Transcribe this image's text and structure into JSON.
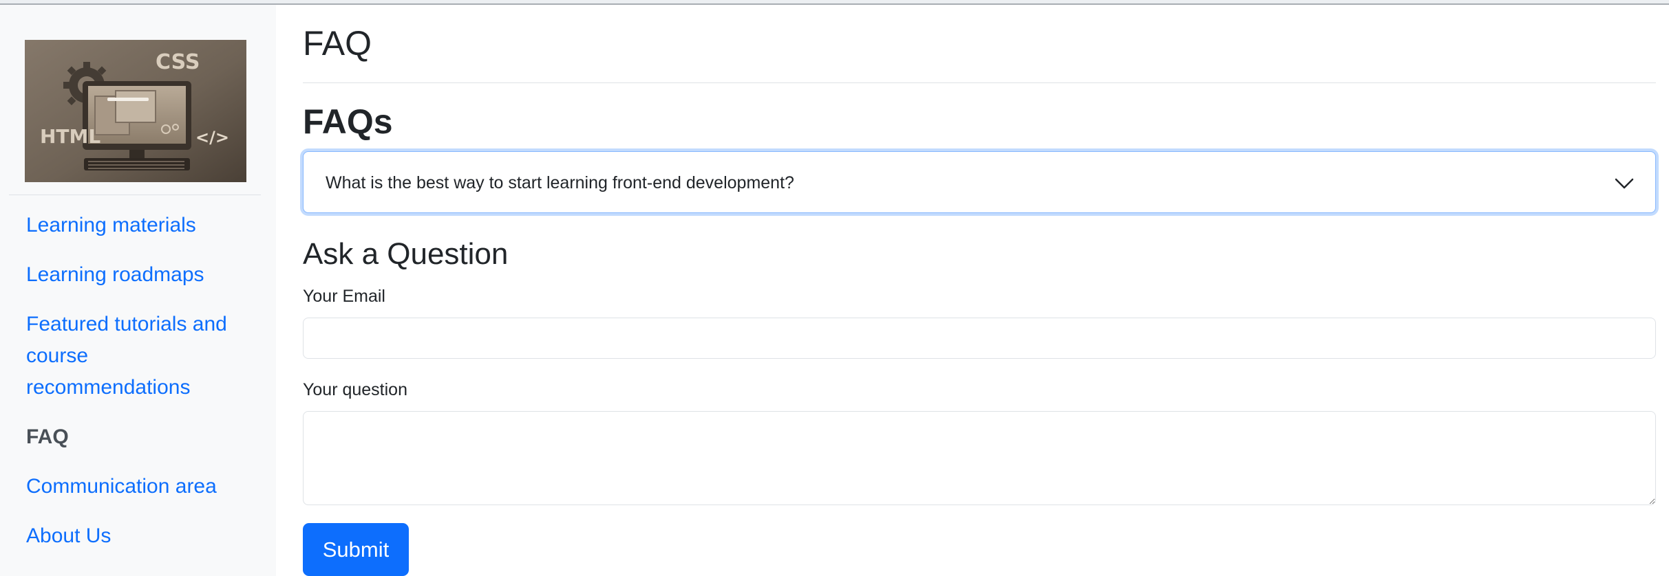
{
  "sidebar": {
    "logo": {
      "icon": "html-css-logo-icon",
      "text_left": "HTML",
      "text_top": "CSS",
      "code_glyph": "</>"
    },
    "nav": [
      {
        "label": "Learning materials",
        "active": false
      },
      {
        "label": "Learning roadmaps",
        "active": false
      },
      {
        "label": "Featured tutorials and course recommendations",
        "active": false
      },
      {
        "label": "FAQ",
        "active": true
      },
      {
        "label": "Communication area",
        "active": false
      },
      {
        "label": "About Us",
        "active": false
      }
    ]
  },
  "main": {
    "page_title": "FAQ",
    "faqs_heading": "FAQs",
    "faq_items": [
      {
        "question": "What is the best way to start learning front-end development?",
        "icon": "chevron-down-icon",
        "expanded": false
      }
    ],
    "ask": {
      "heading": "Ask a Question",
      "email_label": "Your Email",
      "email_value": "",
      "question_label": "Your question",
      "question_value": "",
      "submit_label": "Submit"
    }
  },
  "colors": {
    "link": "#0d6efd",
    "active_nav": "#495057",
    "sidebar_bg": "#f8f9fa",
    "button_bg": "#0d6efd",
    "focus_border": "#86b7fe"
  }
}
